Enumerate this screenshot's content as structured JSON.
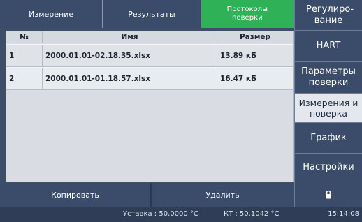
{
  "tabs": [
    {
      "label": "Измерение"
    },
    {
      "label": "Результаты"
    },
    {
      "label": "Протоколы поверки",
      "active": true
    }
  ],
  "table": {
    "columns": [
      "№",
      "Имя",
      "Размер"
    ],
    "rows": [
      {
        "num": "1",
        "name": "2000.01.01-02.18.35.xlsx",
        "size": "13.89 кБ"
      },
      {
        "num": "2",
        "name": "2000.01.01-01.18.57.xlsx",
        "size": "16.47 кБ"
      }
    ]
  },
  "buttons": {
    "copy": "Копировать",
    "delete": "Удалить"
  },
  "sidebar": [
    {
      "label": "Регулиро-вание"
    },
    {
      "label": "HART"
    },
    {
      "label": "Параметры поверки"
    },
    {
      "label": "Измерения и поверка",
      "selected": true
    },
    {
      "label": "График"
    },
    {
      "label": "Настройки"
    }
  ],
  "lock_icon": "lock-icon",
  "status": {
    "setpoint": "Уставка : 50,0000 °C",
    "kt": "КТ : 50,1042 °C",
    "time": "15:14:08"
  }
}
